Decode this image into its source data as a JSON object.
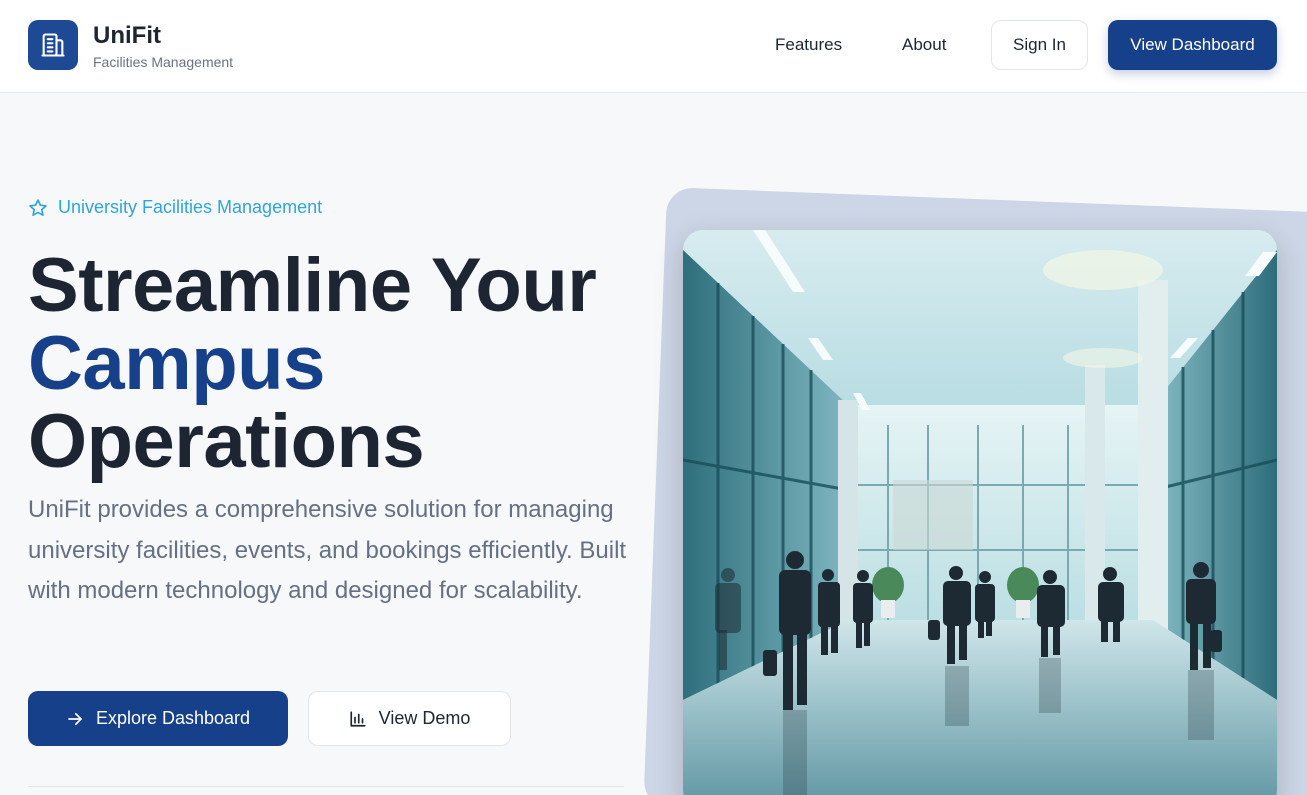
{
  "header": {
    "brand_name": "UniFit",
    "brand_subtitle": "Facilities Management",
    "logo_icon": "building-icon",
    "nav": [
      {
        "label": "Features"
      },
      {
        "label": "About"
      }
    ],
    "signin_label": "Sign In",
    "dashboard_label": "View Dashboard"
  },
  "hero": {
    "tagline": "University Facilities Management",
    "tagline_icon": "star-icon",
    "headline_line1": "Streamline Your",
    "headline_line2": "Campus",
    "headline_line3": "Operations",
    "description": "UniFit provides a comprehensive solution for managing university facilities, events, and bookings efficiently. Built with modern technology and designed for scalability.",
    "explore_label": "Explore Dashboard",
    "explore_icon": "arrow-right-icon",
    "demo_label": "View Demo",
    "demo_icon": "bar-chart-icon"
  },
  "colors": {
    "primary": "#16408a",
    "accent": "#2fa6d8",
    "text": "#1e2532",
    "muted": "#667085"
  }
}
